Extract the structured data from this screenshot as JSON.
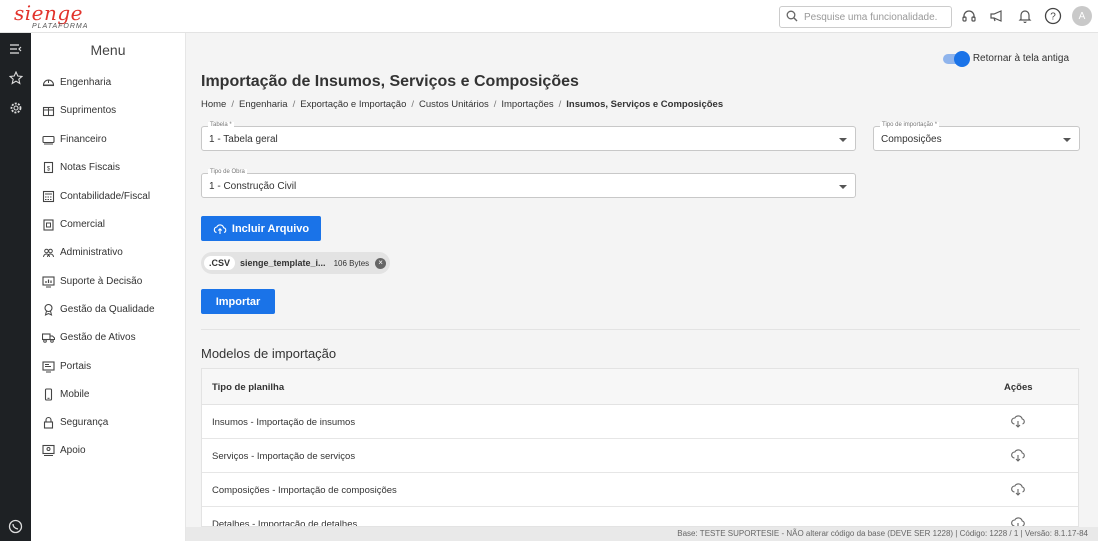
{
  "app": {
    "logo_text": "sienge",
    "logo_sub": "PLATAFORMA",
    "brand_color": "#e2332c",
    "accent_color": "#1a73e8"
  },
  "topbar": {
    "search_placeholder": "Pesquise uma funcionalidade.",
    "icons": [
      "search-icon",
      "headset-icon",
      "megaphone-icon",
      "bell-icon",
      "help-icon"
    ],
    "avatar_initial": "A"
  },
  "rail": {
    "icons": [
      "menu-toggle-icon",
      "star-icon",
      "gear-icon",
      "whatsapp-icon"
    ]
  },
  "menu": {
    "title": "Menu",
    "items": [
      {
        "label": "Engenharia",
        "icon": "helmet-icon"
      },
      {
        "label": "Suprimentos",
        "icon": "box-icon"
      },
      {
        "label": "Financeiro",
        "icon": "money-icon"
      },
      {
        "label": "Notas Fiscais",
        "icon": "invoice-icon"
      },
      {
        "label": "Contabilidade/Fiscal",
        "icon": "calculator-icon"
      },
      {
        "label": "Comercial",
        "icon": "store-icon"
      },
      {
        "label": "Administrativo",
        "icon": "people-icon"
      },
      {
        "label": "Suporte à Decisão",
        "icon": "chart-icon"
      },
      {
        "label": "Gestão da Qualidade",
        "icon": "award-icon"
      },
      {
        "label": "Gestão de Ativos",
        "icon": "truck-icon"
      },
      {
        "label": "Portais",
        "icon": "portal-icon"
      },
      {
        "label": "Mobile",
        "icon": "mobile-icon"
      },
      {
        "label": "Segurança",
        "icon": "lock-icon"
      },
      {
        "label": "Apoio",
        "icon": "support-icon"
      }
    ]
  },
  "main": {
    "toggle_label": "Retornar à tela antiga",
    "toggle_on": true,
    "title": "Importação de Insumos, Serviços e Composições",
    "breadcrumb": [
      "Home",
      "Engenharia",
      "Exportação e Importação",
      "Custos Unitários",
      "Importações",
      "Insumos, Serviços e Composições"
    ],
    "fields": {
      "tabela": {
        "label": "Tabela *",
        "value": "1 - Tabela geral"
      },
      "tipo_importacao": {
        "label": "Tipo de importação *",
        "value": "Composições"
      },
      "tipo_obra": {
        "label": "Tipo de Obra",
        "value": "1 - Construção Civil"
      }
    },
    "include_button": "Incluir Arquivo",
    "file_chip": {
      "ext": ".CSV",
      "name": "sienge_template_i...",
      "size": "106 Bytes"
    },
    "import_button": "Importar",
    "models_title": "Modelos de importação",
    "table": {
      "headers": [
        "Tipo de planilha",
        "Ações"
      ],
      "rows": [
        {
          "label": "Insumos - Importação de insumos",
          "action_icon": "cloud-download-icon"
        },
        {
          "label": "Serviços - Importação de serviços",
          "action_icon": "cloud-download-icon"
        },
        {
          "label": "Composições - Importação de composições",
          "action_icon": "cloud-download-icon"
        },
        {
          "label": "Detalhes - Importação de detalhes",
          "action_icon": "cloud-download-icon"
        }
      ]
    }
  },
  "statusbar": {
    "text": "Base: TESTE SUPORTESIE - NÃO alterar código da base (DEVE SER 1228) | Código: 1228 / 1 | Versão: 8.1.17-84"
  }
}
